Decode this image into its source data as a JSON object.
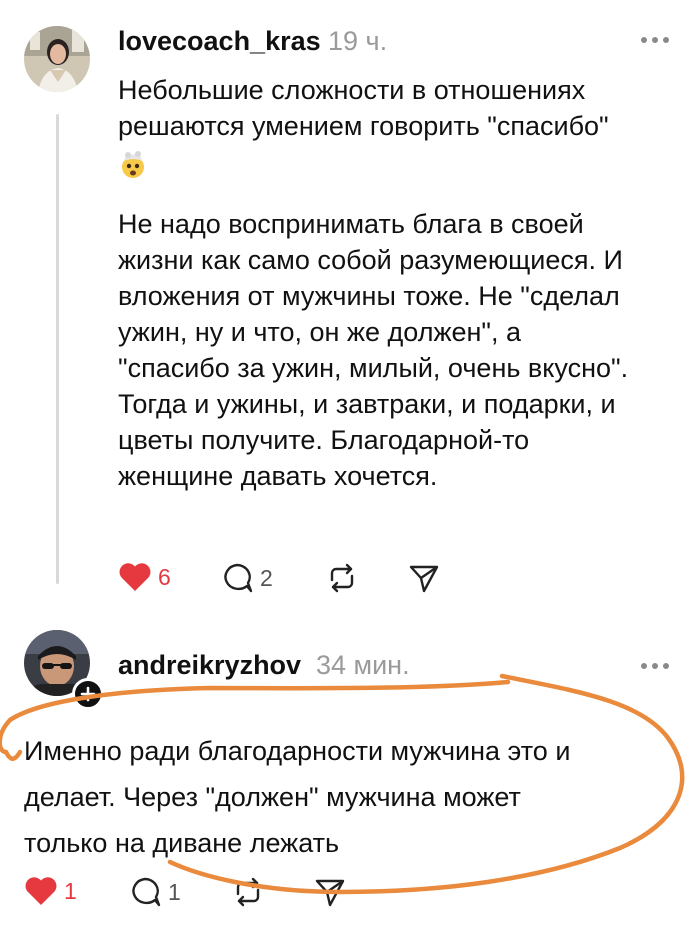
{
  "posts": [
    {
      "username": "lovecoach_kras",
      "time": "19 ч.",
      "text_line1": "Небольшие сложности в отношениях",
      "text_line2": "решаются умением говорить \"спасибо\"",
      "emoji": "exploding-head-emoji",
      "paragraph2": [
        "Не надо воспринимать блага в своей",
        "жизни как само собой разумеющиеся. И",
        "вложения от мужчины тоже. Не \"сделал",
        "ужин, ну и что, он же должен\", а",
        "\"спасибо за ужин, милый, очень вкусно\".",
        "Тогда и ужины, и завтраки, и подарки, и",
        "цветы получите. Благодарной-то",
        "женщине давать хочется."
      ],
      "likes": "6",
      "comments": "2"
    },
    {
      "username": "andreikryzhov",
      "time": "34 мин.",
      "paragraph": [
        "Именно ради благодарности мужчина это и",
        "делает. Через \"должен\" мужчина может",
        "только на диване лежать"
      ],
      "likes": "1",
      "comments": "1"
    }
  ],
  "icons": {
    "like": "heart-icon",
    "comment": "comment-bubble-icon",
    "repost": "repost-icon",
    "share": "send-icon",
    "more": "more-dots-icon"
  },
  "colors": {
    "like_red": "#e6393f",
    "scribble_orange": "#e98a3c",
    "muted_gray": "#9a9a9a"
  }
}
